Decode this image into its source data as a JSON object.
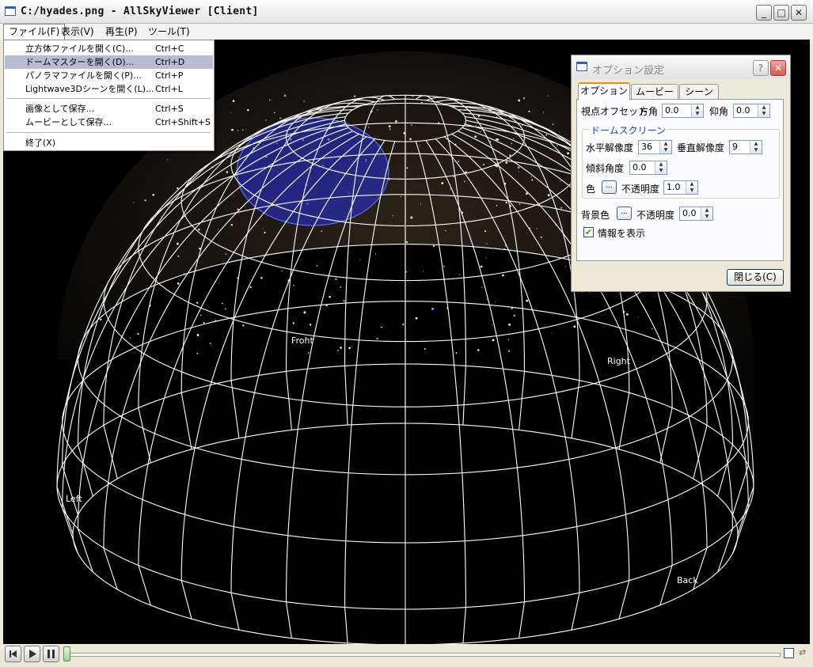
{
  "window": {
    "title": "C:/hyades.png - AllSkyViewer [Client]",
    "min_label": "_",
    "max_label": "□",
    "close_label": "✕"
  },
  "menubar": [
    {
      "label": "ファイル(F)"
    },
    {
      "label": "表示(V)"
    },
    {
      "label": "再生(P)"
    },
    {
      "label": "ツール(T)"
    }
  ],
  "file_menu": [
    {
      "label": "立方体ファイルを開く(C)...",
      "shortcut": "Ctrl+C"
    },
    {
      "label": "ドームマスターを開く(D)...",
      "shortcut": "Ctrl+D"
    },
    {
      "label": "パノラマファイルを開く(P)...",
      "shortcut": "Ctrl+P"
    },
    {
      "label": "Lightwave3Dシーンを開く(L)...",
      "shortcut": "Ctrl+L"
    },
    {
      "label": "画像として保存...",
      "shortcut": "Ctrl+S"
    },
    {
      "label": "ムービーとして保存...",
      "shortcut": "Ctrl+Shift+S"
    },
    {
      "label": "終了(X)",
      "shortcut": ""
    }
  ],
  "viewport": {
    "labels": {
      "front": "Front",
      "right": "Right",
      "left": "Left",
      "back": "Back"
    }
  },
  "dialog": {
    "title": "オプション設定",
    "help_label": "?",
    "close_label": "✕",
    "tabs": [
      {
        "label": "オプション"
      },
      {
        "label": "ムービー"
      },
      {
        "label": "シーン"
      }
    ],
    "view_offset_label": "視点オフセット",
    "azimuth_label": "方角",
    "azimuth_value": "0.0",
    "elevation_label": "仰角",
    "elevation_value": "0.0",
    "dome_group_title": "ドームスクリーン",
    "h_res_label": "水平解像度",
    "h_res_value": "36",
    "v_res_label": "垂直解像度",
    "v_res_value": "9",
    "tilt_label": "傾斜角度",
    "tilt_value": "0.0",
    "color_label": "色",
    "color_btn": "...",
    "opacity_label": "不透明度",
    "opacity_value": "1.0",
    "bg_color_label": "背景色",
    "bg_btn": "...",
    "bg_opacity_label": "不透明度",
    "bg_opacity_value": "0.0",
    "show_info_label": "情報を表示",
    "show_info_checked": "✔",
    "close_button": "閉じる(C)"
  },
  "player": {
    "loop_icon": "⇄"
  }
}
